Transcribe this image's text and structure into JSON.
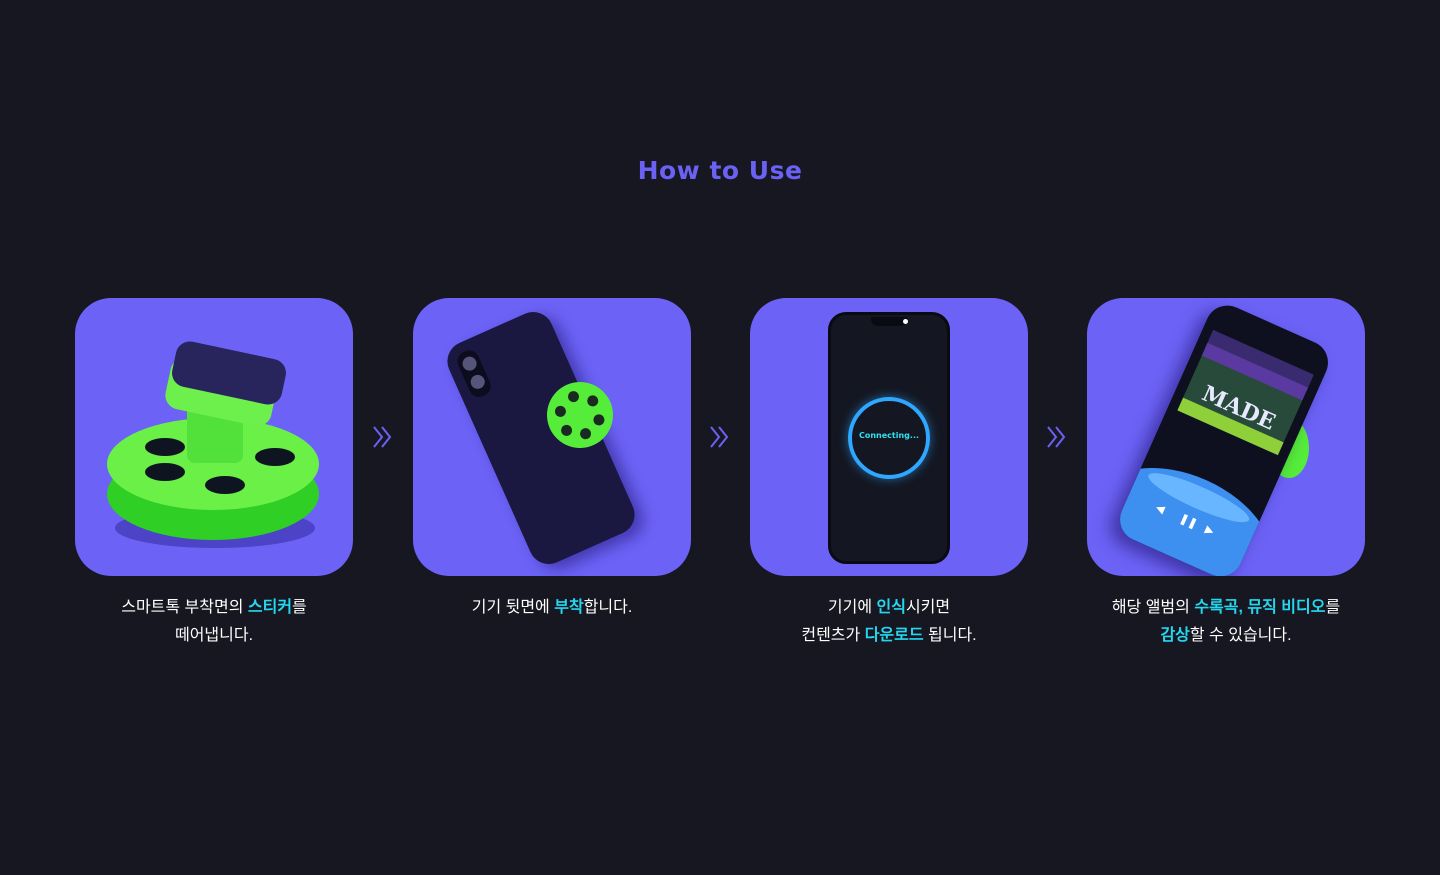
{
  "header": {
    "title": "How to Use"
  },
  "colors": {
    "background": "#161720",
    "card": "#6c62f6",
    "title": "#6b61f5",
    "highlight": "#25d7f0",
    "grip": "#56ec3a"
  },
  "steps": [
    {
      "line1": {
        "a": "스마트톡 부착면의 ",
        "hl": "스티커",
        "b": "를"
      },
      "line2": {
        "a": "떼어냅니다."
      },
      "icon": "reel-grip-illustration"
    },
    {
      "line1": {
        "a": "기기 뒷면에 ",
        "hl": "부착",
        "b": "합니다."
      },
      "icon": "phone-back-grip-illustration"
    },
    {
      "line1": {
        "a": "기기에 ",
        "hl": "인식",
        "b": "시키면"
      },
      "line2": {
        "a": "컨텐츠가 ",
        "hl": "다운로드",
        "b": " 됩니다."
      },
      "screen_text": "Connecting...",
      "icon": "phone-connecting-illustration"
    },
    {
      "line1": {
        "a": "해당 앨범의 ",
        "hl": "수록곡, 뮤직 비디오",
        "b": "를"
      },
      "line2": {
        "hl": "감상",
        "b": "할 수 있습니다."
      },
      "album_word": "MADE",
      "icon": "phone-player-illustration"
    }
  ],
  "arrows": [
    "chevrons-right-icon",
    "chevrons-right-icon",
    "chevrons-right-icon"
  ]
}
